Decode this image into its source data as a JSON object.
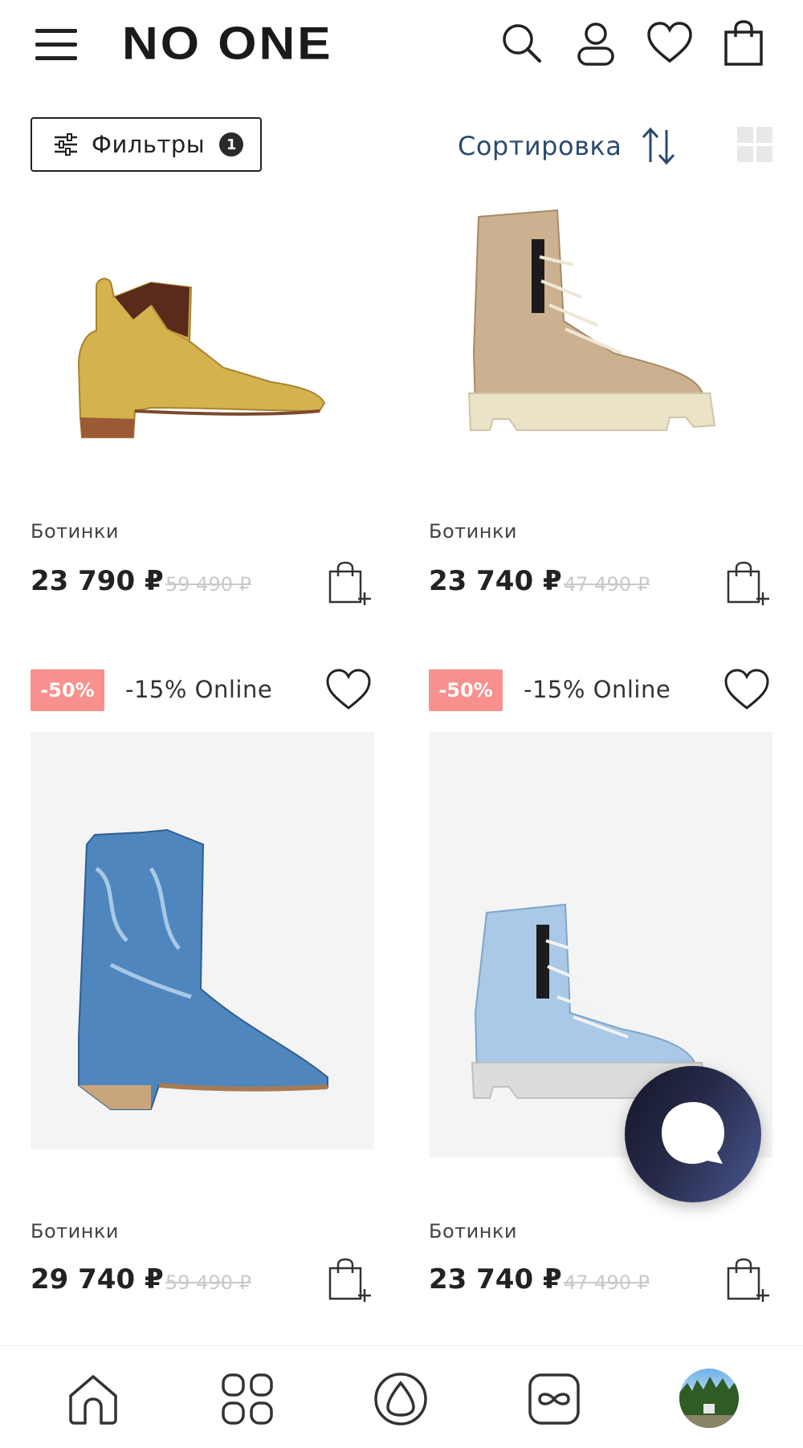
{
  "header": {
    "logo": "NO ONE",
    "icons": [
      "menu-icon",
      "search-icon",
      "user-icon",
      "heart-icon",
      "shopping-bag-icon"
    ]
  },
  "toolbar": {
    "filters_label": "Фильтры",
    "filters_count": "1",
    "sort_label": "Сортировка",
    "grid_toggle_icon": "grid-icon"
  },
  "products": [
    {
      "category": "Ботинки",
      "price": "23 790 ₽",
      "old_price": "59 490 ₽",
      "image": "gold-cowboy-chelsea-boot"
    },
    {
      "category": "Ботинки",
      "price": "23 740 ₽",
      "old_price": "47 490 ₽",
      "image": "beige-canvas-platform-boot"
    },
    {
      "badge": "-50%",
      "promo": "-15% Online",
      "category": "Ботинки",
      "price": "29 740 ₽",
      "old_price": "59 490 ₽",
      "image": "denim-cowboy-boot"
    },
    {
      "badge": "-50%",
      "promo": "-15% Online",
      "category": "Ботинки",
      "price": "23 740 ₽",
      "old_price": "47 490 ₽",
      "image": "light-denim-platform-boot"
    }
  ],
  "colors": {
    "badge": "#f8908e",
    "sort_text": "#2c4a6e",
    "old_price": "#c9c9c9"
  },
  "bottom_nav": [
    "home-icon",
    "catalog-icon",
    "brand-icon",
    "infinity-icon",
    "profile-avatar"
  ]
}
